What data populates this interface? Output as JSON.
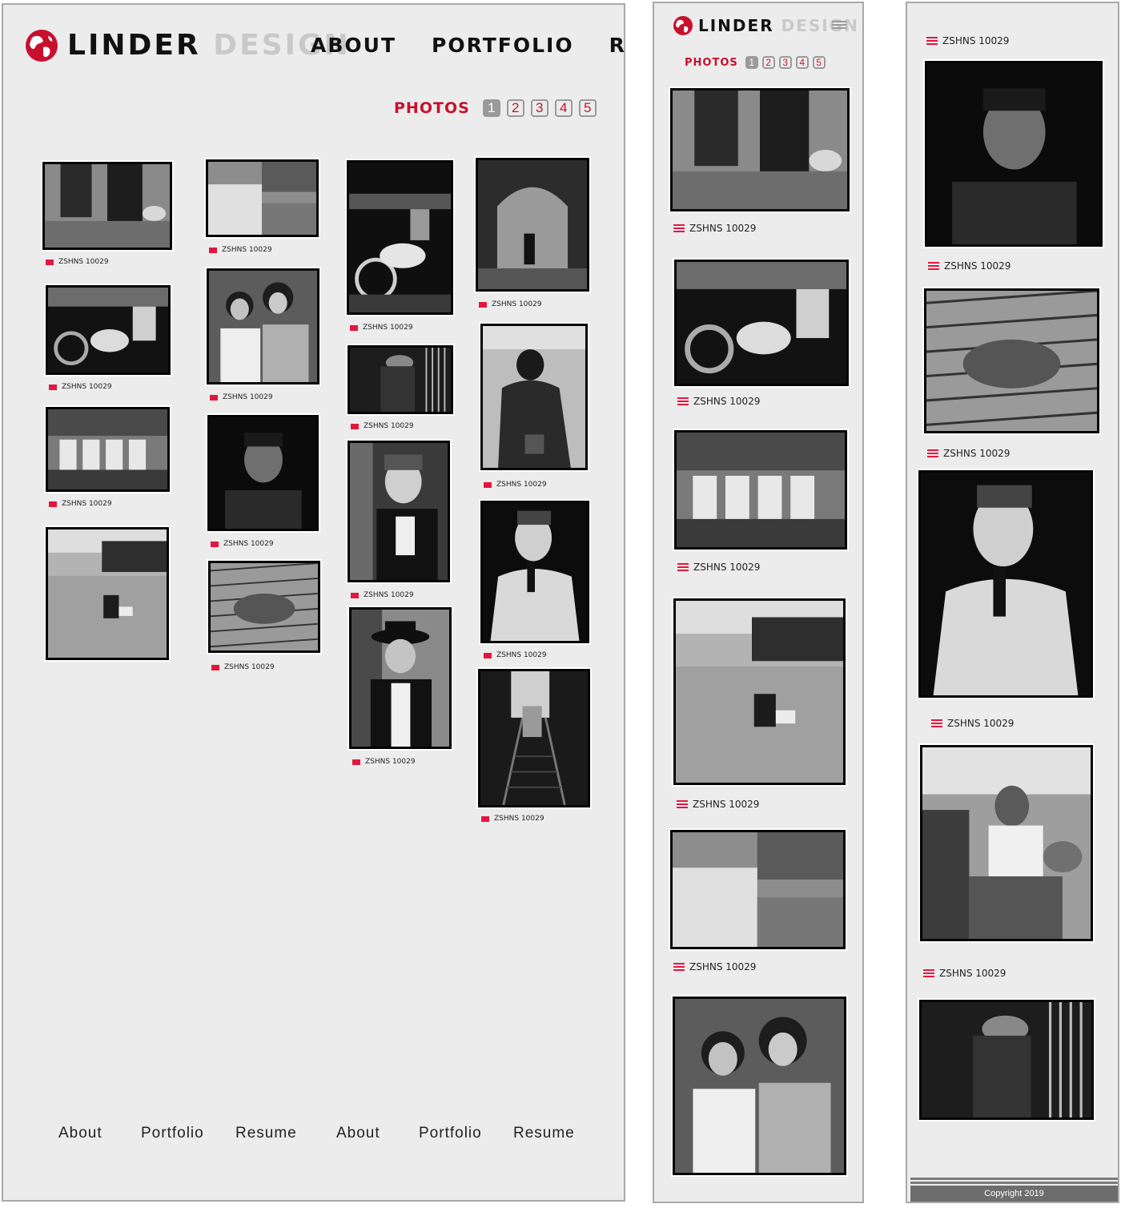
{
  "brand": {
    "word1": "LINDER",
    "word2": "DESIGN"
  },
  "nav": [
    "ABOUT",
    "PORTFOLIO",
    "RESUME"
  ],
  "pager": {
    "label": "PHOTOS",
    "pages": [
      "1",
      "2",
      "3",
      "4",
      "5"
    ],
    "active": "1"
  },
  "photo_caption": "ZSHNS 10029",
  "footer_links": [
    "About",
    "Portfolio",
    "Resume",
    "About",
    "Portfolio",
    "Resume"
  ],
  "copyright": "Copyright 2019",
  "colors": {
    "accent": "#c8102e",
    "panel_bg": "#ececec",
    "border": "#a9a9a9",
    "muted": "#c9c9c9",
    "flag": "#e3173e"
  },
  "icons": [
    "globe-icon",
    "hamburger-icon",
    "caption-flag-icon"
  ],
  "photos": {
    "desktop": [
      "police-arrest",
      "taxi-street",
      "biker-night",
      "archway-alley",
      "biker-garage",
      "mother-daughter",
      "man-railing",
      "woman-fur-coat",
      "girls-bench",
      "young-man-portrait",
      "woman-laughing",
      "man-revolver",
      "man-beach",
      "hyena",
      "man-hat",
      "subway-stairs"
    ],
    "mobile": [
      "police-arrest",
      "biker-garage",
      "girls-bench",
      "man-beach",
      "taxi-street",
      "mother-daughter"
    ],
    "mobile2": [
      "young-man-portrait",
      "hyena",
      "man-revolver",
      "woman-sitting",
      "man-railing"
    ]
  }
}
